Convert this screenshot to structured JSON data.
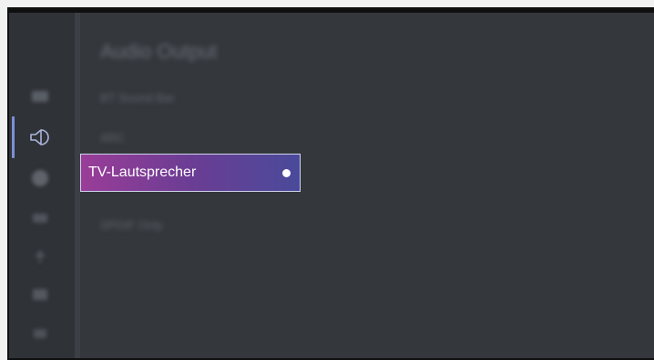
{
  "menu": {
    "title": "Audio Output",
    "items": [
      {
        "label": "BT Sound Bar"
      },
      {
        "label": "ARC"
      },
      {
        "label": "TV-Lautsprecher",
        "selected": true
      },
      {
        "label": "SPDIF Only"
      }
    ]
  },
  "sidebar": {
    "icons": [
      {
        "name": "picture-icon"
      },
      {
        "name": "sound-icon",
        "active": true
      },
      {
        "name": "network-icon"
      },
      {
        "name": "channel-icon"
      },
      {
        "name": "antenna-icon"
      },
      {
        "name": "apps-icon"
      },
      {
        "name": "system-icon"
      }
    ]
  },
  "colors": {
    "background": "#34373c",
    "selection_gradient_start": "#9a3d98",
    "selection_gradient_end": "#4a4a9a",
    "accent": "#7d8fd6"
  }
}
